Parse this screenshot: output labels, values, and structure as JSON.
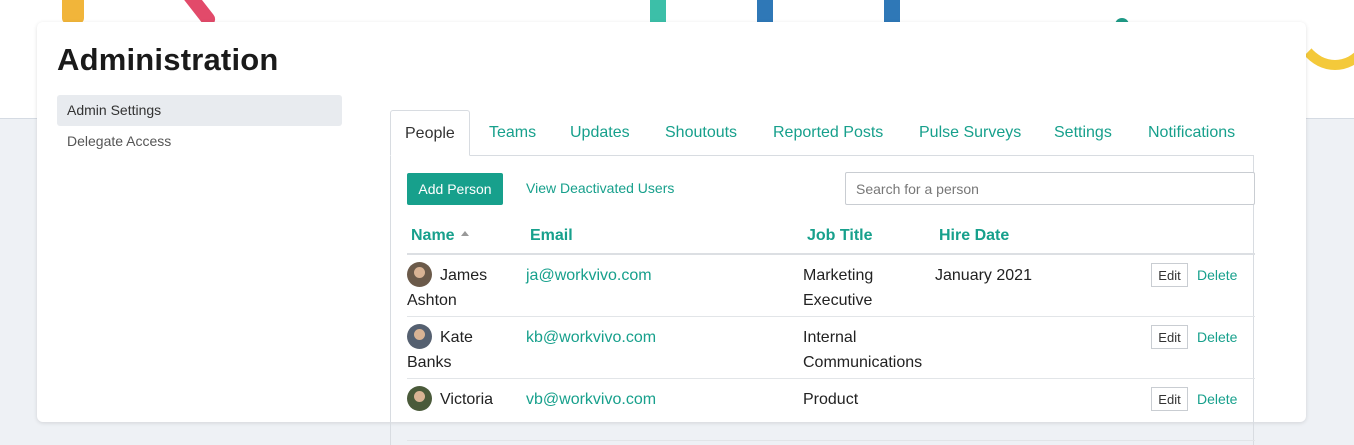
{
  "page": {
    "title": "Administration"
  },
  "sidebar": {
    "items": [
      {
        "label": "Admin Settings"
      },
      {
        "label": "Delegate Access"
      }
    ]
  },
  "tabs": [
    {
      "label": "People"
    },
    {
      "label": "Teams"
    },
    {
      "label": "Updates"
    },
    {
      "label": "Shoutouts"
    },
    {
      "label": "Reported Posts"
    },
    {
      "label": "Pulse Surveys"
    },
    {
      "label": "Settings"
    },
    {
      "label": "Notifications"
    }
  ],
  "toolbar": {
    "add_person_label": "Add Person",
    "view_deactivated_label": "View Deactivated Users",
    "search_placeholder": "Search for a person"
  },
  "table": {
    "columns": {
      "name": "Name",
      "email": "Email",
      "job_title": "Job Title",
      "hire_date": "Hire Date"
    },
    "edit_label": "Edit",
    "delete_label": "Delete",
    "rows": [
      {
        "first": "James",
        "last": "Ashton",
        "email": "ja@workvivo.com",
        "job1": "Marketing",
        "job2": "Executive",
        "hire": "January 2021"
      },
      {
        "first": "Kate",
        "last": "Banks",
        "email": "kb@workvivo.com",
        "job1": "Internal",
        "job2": "Communications",
        "hire": ""
      },
      {
        "first": "Victoria",
        "last": "",
        "email": "vb@workvivo.com",
        "job1": "Product",
        "job2": "",
        "hire": ""
      }
    ]
  },
  "colors": {
    "accent": "#17a08c",
    "active_nav": "#e8ebef"
  }
}
